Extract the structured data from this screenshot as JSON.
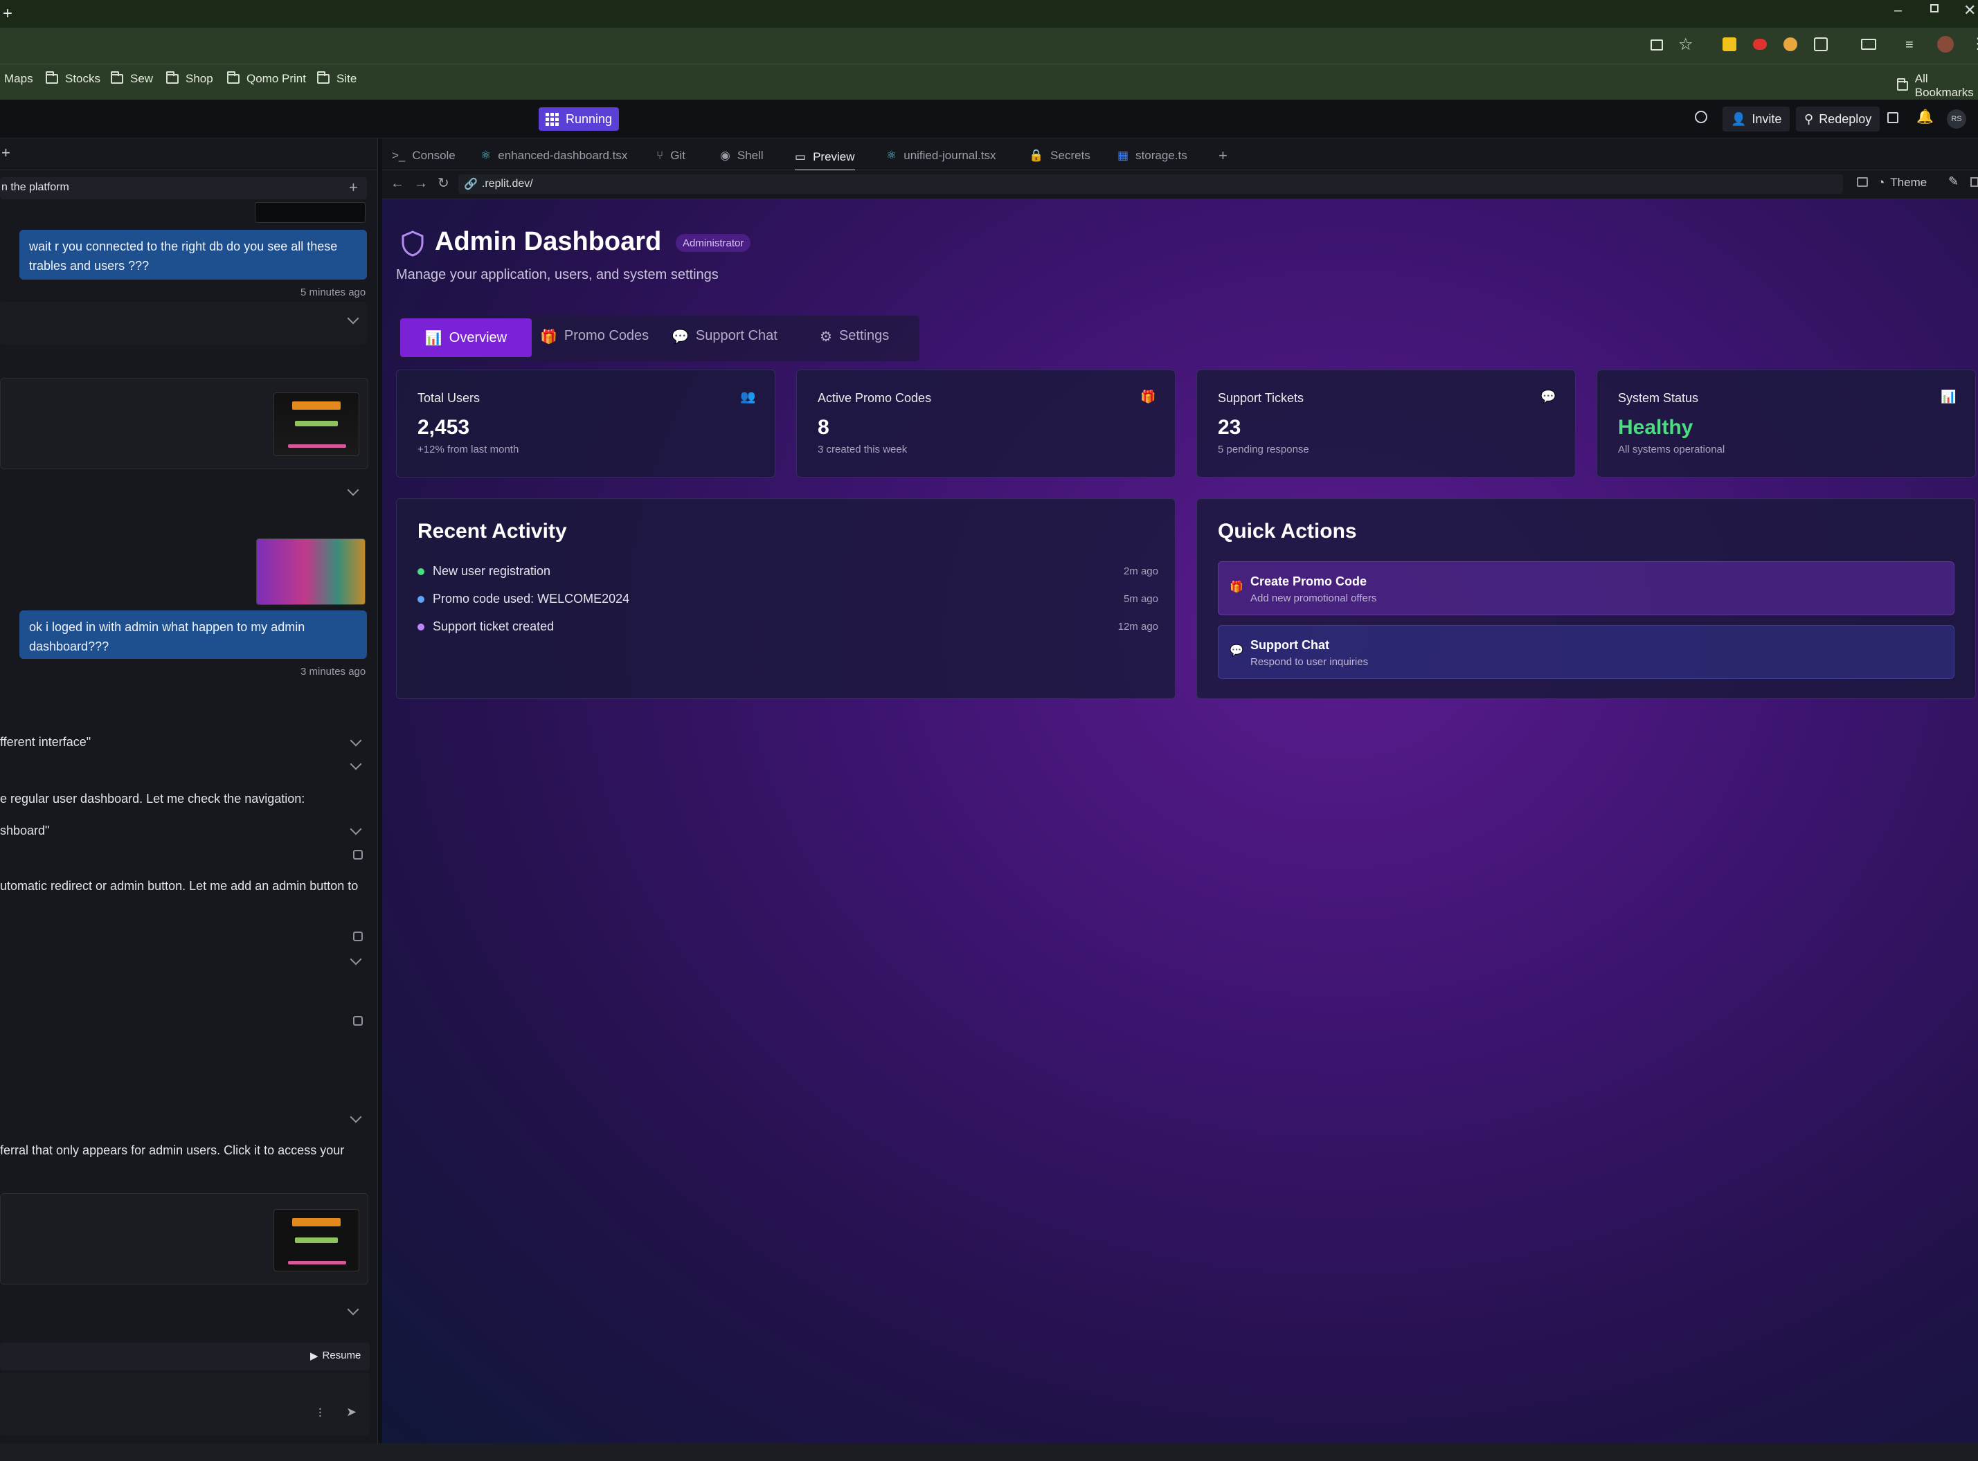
{
  "browser": {
    "bookmarks": [
      "Maps",
      "Stocks",
      "Sew",
      "Shop",
      "Qomo Print",
      "Site"
    ],
    "all_bookmarks": "All Bookmarks"
  },
  "app_header": {
    "status": "Running",
    "invite": "Invite",
    "redeploy": "Redeploy",
    "avatar": "RS"
  },
  "tabs": [
    "Console",
    "enhanced-dashboard.tsx",
    "Git",
    "Shell",
    "Preview",
    "unified-journal.tsx",
    "Secrets",
    "storage.ts"
  ],
  "address": {
    "url": ".replit.dev/",
    "theme": "Theme"
  },
  "chat": {
    "header": "n the platform",
    "msg1": "wait r you connected to the right db do you see all these trables and users ???",
    "time1": "5 minutes ago",
    "msg2": "ok i loged in with admin what happen to my admin dashboard???",
    "time2": "3 minutes ago",
    "line1": "fferent interface\"",
    "line2": "e regular user dashboard. Let me check the navigation:",
    "line3": "shboard\"",
    "line4": "utomatic redirect or admin button. Let me add an admin button to",
    "line5": "ferral that only appears for admin users. Click it to access your",
    "resume": "Resume"
  },
  "dashboard": {
    "title": "Admin Dashboard",
    "badge": "Administrator",
    "subtitle": "Manage your application, users, and system settings",
    "nav": [
      "Overview",
      "Promo Codes",
      "Support Chat",
      "Settings"
    ],
    "stats": [
      {
        "label": "Total Users",
        "value": "2,453",
        "sub": "+12% from last month"
      },
      {
        "label": "Active Promo Codes",
        "value": "8",
        "sub": "3 created this week"
      },
      {
        "label": "Support Tickets",
        "value": "23",
        "sub": "5 pending response"
      },
      {
        "label": "System Status",
        "value": "Healthy",
        "sub": "All systems operational"
      }
    ],
    "recent_title": "Recent Activity",
    "activity": [
      {
        "text": "New user registration",
        "time": "2m ago",
        "color": "#4ade80"
      },
      {
        "text": "Promo code used: WELCOME2024",
        "time": "5m ago",
        "color": "#60a5fa"
      },
      {
        "text": "Support ticket created",
        "time": "12m ago",
        "color": "#c084fc"
      }
    ],
    "quick_title": "Quick Actions",
    "actions": [
      {
        "title": "Create Promo Code",
        "sub": "Add new promotional offers"
      },
      {
        "title": "Support Chat",
        "sub": "Respond to user inquiries"
      }
    ]
  },
  "colors": {
    "accent": "#7c22d6",
    "healthy": "#4ade80",
    "chat_bubble": "#1e4f8f"
  }
}
